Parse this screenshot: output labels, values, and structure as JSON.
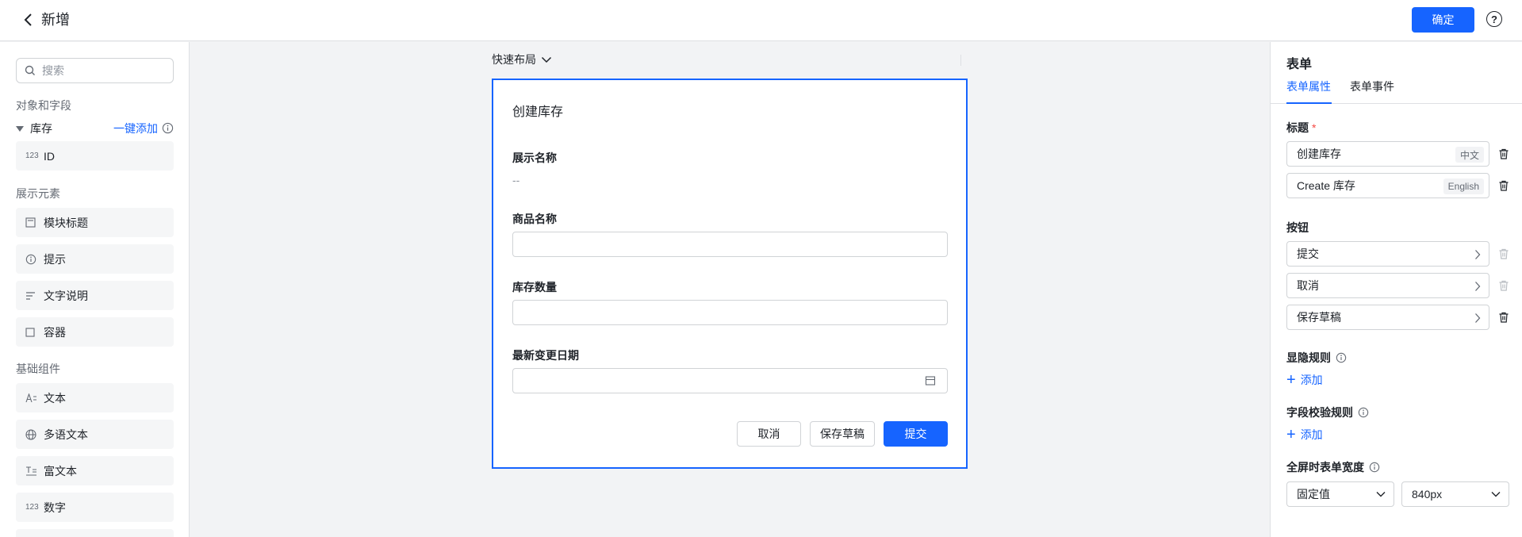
{
  "header": {
    "title": "新增",
    "confirm_label": "确定",
    "help_glyph": "?"
  },
  "sidebar": {
    "search_placeholder": "搜索",
    "objects_section": "对象和字段",
    "object_name": "库存",
    "add_all_label": "一键添加",
    "object_fields": [
      {
        "icon_text": "123",
        "label": "ID"
      }
    ],
    "display_section": "展示元素",
    "display_items": [
      {
        "icon": "module-title-icon",
        "label": "模块标题"
      },
      {
        "icon": "info-icon",
        "label": "提示"
      },
      {
        "icon": "text-lines-icon",
        "label": "文字说明"
      },
      {
        "icon": "container-icon",
        "label": "容器"
      }
    ],
    "basic_section": "基础组件",
    "basic_items": [
      {
        "icon": "text-icon",
        "label": "文本"
      },
      {
        "icon": "globe-icon",
        "label": "多语文本"
      },
      {
        "icon": "rich-text-icon",
        "label": "富文本"
      },
      {
        "icon_text": "123",
        "label": "数字"
      }
    ]
  },
  "canvas": {
    "quick_layout_label": "快速布局",
    "form": {
      "title": "创建库存",
      "fields": [
        {
          "label": "展示名称",
          "value": "--"
        },
        {
          "label": "商品名称",
          "value": ""
        },
        {
          "label": "库存数量",
          "value": ""
        },
        {
          "label": "最新变更日期",
          "value": ""
        }
      ],
      "buttons": {
        "cancel": "取消",
        "save_draft": "保存草稿",
        "submit": "提交"
      }
    }
  },
  "right_panel": {
    "title": "表单",
    "tabs": [
      "表单属性",
      "表单事件"
    ],
    "active_tab": 0,
    "title_label": "标题",
    "required_mark": "*",
    "title_values": [
      {
        "value": "创建库存",
        "lang": "中文"
      },
      {
        "value": "Create 库存",
        "lang": "English"
      }
    ],
    "buttons_label": "按钮",
    "button_items": [
      "提交",
      "取消",
      "保存草稿"
    ],
    "visibility_rules_label": "显隐规则",
    "validation_rules_label": "字段校验规则",
    "add_label": "添加",
    "fullscreen_width_label": "全屏时表单宽度",
    "width_mode": "固定值",
    "width_value": "840px"
  },
  "colors": {
    "accent": "#1664ff",
    "danger": "#f54a45"
  }
}
